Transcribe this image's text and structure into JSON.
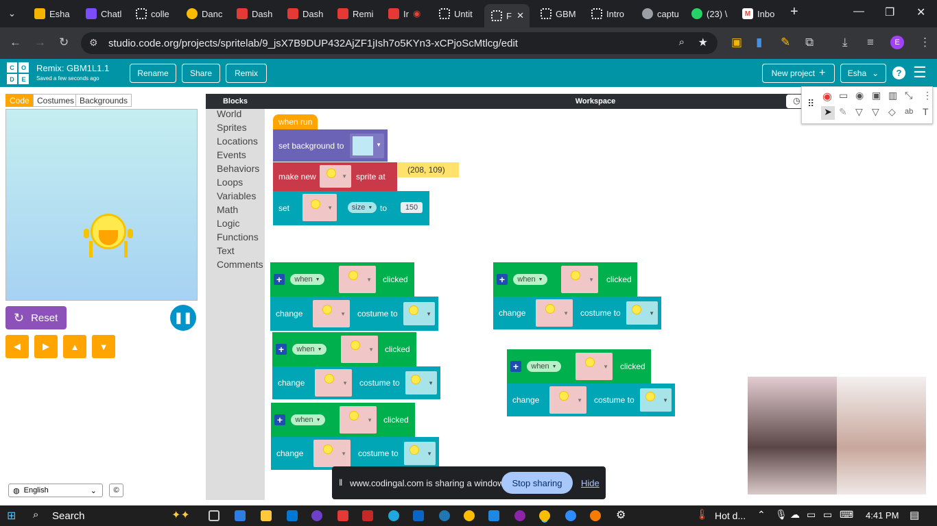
{
  "browser": {
    "tabs": [
      {
        "label": "Esha",
        "color": "#f4b400"
      },
      {
        "label": "Chatl",
        "color": "#7c4dff"
      },
      {
        "label": "colle",
        "color": "#ffffff"
      },
      {
        "label": "Danc",
        "color": "#fbbc04"
      },
      {
        "label": "Dash",
        "color": "#e53935"
      },
      {
        "label": "Dash",
        "color": "#e53935"
      },
      {
        "label": "Remi",
        "color": "#e53935"
      },
      {
        "label": "Ir",
        "color": "#e53935"
      },
      {
        "label": "Untit",
        "color": "#ffffff"
      },
      {
        "label": "F",
        "color": "#ffffff"
      },
      {
        "label": "GBM",
        "color": "#ffffff"
      },
      {
        "label": "Intro",
        "color": "#ffffff"
      },
      {
        "label": "captu",
        "color": "#9aa0a6"
      },
      {
        "label": "(23) \\",
        "color": "#25d366"
      },
      {
        "label": "Inbo",
        "color": "#ea4335"
      }
    ],
    "url": "studio.code.org/projects/spritelab/9_jsX7B9DUP432AjZF1jIsh7o5KYn3-xCPjoScMtlcg/edit",
    "profile_letter": "E"
  },
  "header": {
    "logo_letters": [
      "C",
      "O",
      "D",
      "E"
    ],
    "project_title": "Remix: GBM1L1.1",
    "saved_text": "Saved a few seconds ago",
    "rename_label": "Rename",
    "share_label": "Share",
    "remix_label": "Remix",
    "new_project_label": "New project",
    "user_label": "Esha"
  },
  "left_panel": {
    "tabs": [
      "Code",
      "Costumes",
      "Backgrounds"
    ],
    "reset_label": "Reset",
    "language": "English"
  },
  "toolbox": {
    "header": "Blocks",
    "categories": [
      "World",
      "Sprites",
      "Locations",
      "Events",
      "Behaviors",
      "Loops",
      "Variables",
      "Math",
      "Logic",
      "Functions",
      "Text",
      "Comments"
    ]
  },
  "workspace": {
    "header": "Workspace",
    "when_run": "when run",
    "set_background": "set background to",
    "make_new": "make new",
    "sprite_at": "sprite at",
    "location_value": "(208, 109)",
    "set_label": "set",
    "size_label": "size",
    "to_label": "to",
    "size_value": "150",
    "when_label": "when",
    "clicked_label": "clicked",
    "change_label": "change",
    "costume_to_label": "costume to"
  },
  "share_bar": {
    "message": "www.codingal.com is sharing a window.",
    "stop_label": "Stop sharing",
    "hide_label": "Hide"
  },
  "taskbar": {
    "search_label": "Search",
    "weather_label": "Hot d...",
    "time": "4:41 PM"
  }
}
